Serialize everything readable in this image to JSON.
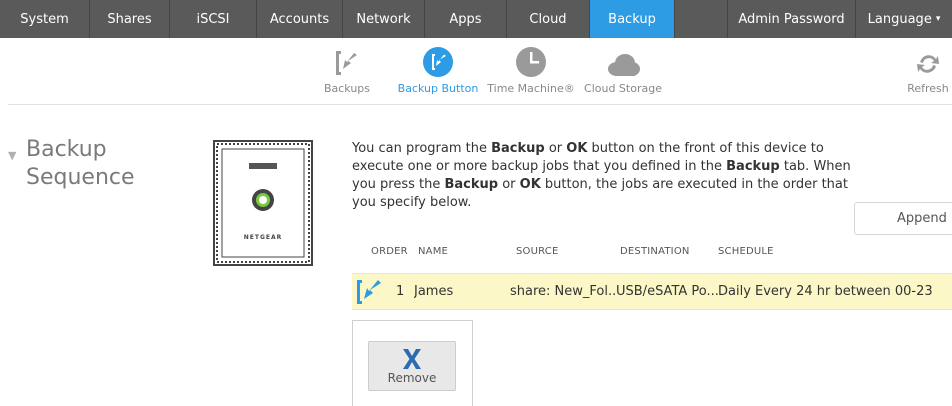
{
  "topnav": {
    "tabs": [
      {
        "label": "System"
      },
      {
        "label": "Shares"
      },
      {
        "label": "iSCSI"
      },
      {
        "label": "Accounts"
      },
      {
        "label": "Network"
      },
      {
        "label": "Apps"
      },
      {
        "label": "Cloud"
      },
      {
        "label": "Backup",
        "active": true
      },
      {
        "label": ""
      },
      {
        "label": "Admin Password"
      },
      {
        "label": "Language"
      }
    ],
    "language_caret": "▾"
  },
  "subnav": {
    "items": [
      {
        "label": "Backups",
        "icon": "backup-arrow-icon"
      },
      {
        "label": "Backup Button",
        "icon": "backup-button-icon",
        "active": true
      },
      {
        "label": "Time Machine®",
        "icon": "clock-icon"
      },
      {
        "label": "Cloud Storage",
        "icon": "cloud-icon"
      }
    ],
    "refresh_label": "Refresh"
  },
  "section": {
    "title": "Backup Sequence"
  },
  "device": {
    "brand": "NETGEAR"
  },
  "description": {
    "p1": "You can program the ",
    "b1": "Backup",
    "p2": " or ",
    "b2": "OK",
    "p3": " button on the front of this device to execute one or more backup jobs that you defined in the ",
    "b3": "Backup",
    "p4": " tab. When you press the ",
    "b4": "Backup",
    "p5": " or ",
    "b5": "OK",
    "p6": " button, the jobs are executed in the order that you specify below."
  },
  "append_label": "Append",
  "table": {
    "headers": {
      "order": "ORDER",
      "name": "NAME",
      "source": "SOURCE",
      "destination": "DESTINATION",
      "schedule": "SCHEDULE"
    },
    "rows": [
      {
        "order": "1",
        "name": "James",
        "source": "share: New_Fol...",
        "destination": "USB/eSATA Po...",
        "schedule": "Daily Every 24 hr between 00-23"
      }
    ]
  },
  "popup": {
    "remove_label": "Remove"
  },
  "colors": {
    "accent": "#2e9be5",
    "nav_bg": "#5a5a5a",
    "row_highlight": "#fbf7c6"
  }
}
